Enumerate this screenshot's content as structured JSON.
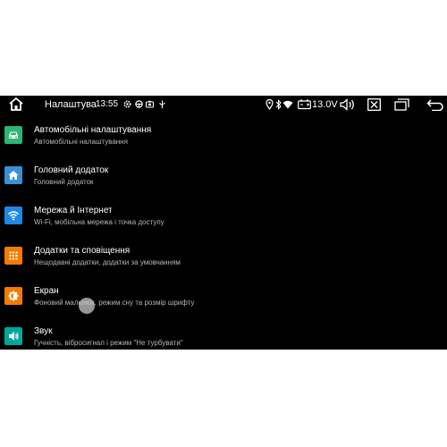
{
  "statusbar": {
    "title": "Налаштува",
    "time": "13:55",
    "voltage": "13.0V",
    "left_icons": [
      "home-icon",
      "settings-notification-icon",
      "steering-wheel-icon",
      "camera-icon",
      "usb-icon"
    ],
    "right_icons": [
      "location-icon",
      "bluetooth-icon",
      "wifi-icon",
      "battery-icon",
      "volume-icon",
      "close-icon",
      "recent-apps-icon",
      "back-icon"
    ]
  },
  "settings": {
    "items": [
      {
        "title": "Автомобільні налаштування",
        "subtitle": "Автомобільні налаштування",
        "icon": "car-icon",
        "color": "#2bb673"
      },
      {
        "title": "Головний додаток",
        "subtitle": "Головний додаток",
        "icon": "home-icon",
        "color": "#3b8fd9"
      },
      {
        "title": "Мережа й Інтернет",
        "subtitle": "Wi-Fi, мобільна мережа і точка доступу",
        "icon": "wifi-icon",
        "color": "#1e88e5"
      },
      {
        "title": "Додатки та сповіщення",
        "subtitle": "Нещодавні додатки, додатки за умовчанням",
        "icon": "apps-grid-icon",
        "color": "#f57c00"
      },
      {
        "title": "Екран",
        "subtitle": "Фоновий малюнок, режим сну та розмір шрифту",
        "icon": "brightness-icon",
        "color": "#f57c00"
      },
      {
        "title": "Звук",
        "subtitle": "Гучність, вібросигнал і режим \"Не турбувати\"",
        "icon": "speaker-icon",
        "color": "#00a79d"
      }
    ]
  }
}
